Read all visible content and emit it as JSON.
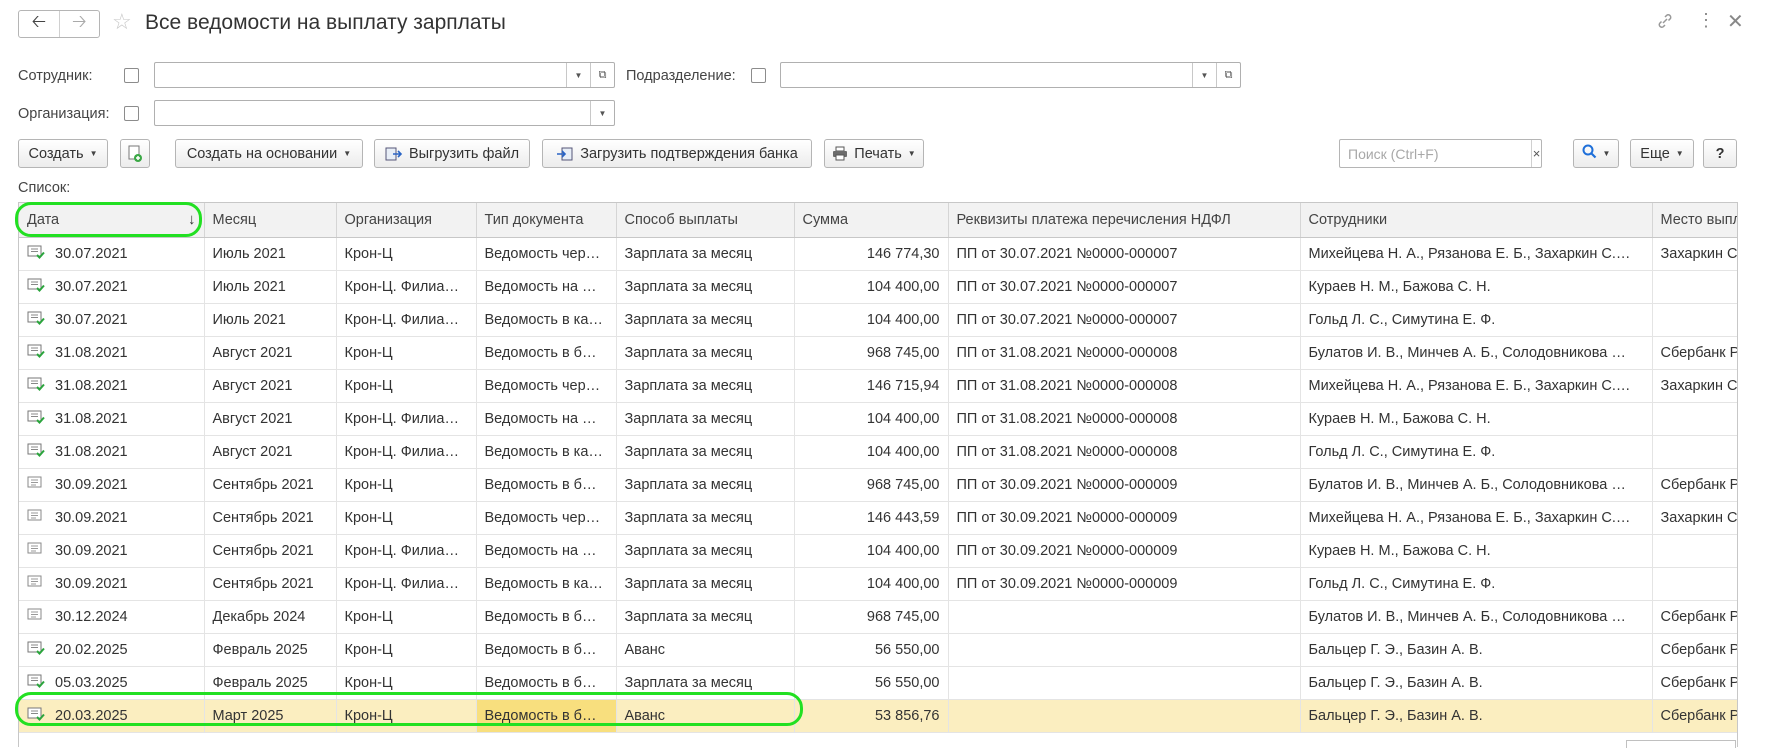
{
  "window": {
    "title": "Все ведомости на выплату зарплаты",
    "back_icon": "arrow-left-icon",
    "forward_icon": "arrow-right-icon",
    "favorite_icon": "star-icon",
    "link_icon": "link-icon",
    "more_icon": "more-vertical-icon",
    "close_icon": "close-icon"
  },
  "filters": {
    "employee_label": "Сотрудник:",
    "department_label": "Подразделение:",
    "organization_label": "Организация:",
    "employee_value": "",
    "department_value": "",
    "organization_value": ""
  },
  "toolbar": {
    "create": "Создать",
    "create_based_on": "Создать на основании",
    "export_file": "Выгрузить файл",
    "load_bank_confirm": "Загрузить подтверждения банка",
    "print": "Печать",
    "search_placeholder": "Поиск (Ctrl+F)",
    "search_clear": "×",
    "more": "Еще",
    "help": "?"
  },
  "list_label": "Список:",
  "table": {
    "columns": [
      "Дата",
      "Месяц",
      "Организация",
      "Тип документа",
      "Способ выплаты",
      "Сумма",
      "Реквизиты платежа перечисления НДФЛ",
      "Сотрудники",
      "Место выпл"
    ],
    "sort_column": "Дата",
    "sort_direction": "↓",
    "rows": [
      {
        "date": "30.07.2021",
        "month": "Июль 2021",
        "org": "Крон-Ц",
        "type": "Ведомость чер…",
        "method": "Зарплата за месяц",
        "sum": "146 774,30",
        "ndfl": "ПП от 30.07.2021 №0000-000007",
        "employees": "Михейцева Н. А., Рязанова Е. Б., Захаркин С.…",
        "place": "Захаркин Са",
        "posted": true
      },
      {
        "date": "30.07.2021",
        "month": "Июль 2021",
        "org": "Крон-Ц. Филиа…",
        "type": "Ведомость на …",
        "method": "Зарплата за месяц",
        "sum": "104 400,00",
        "ndfl": "ПП от 30.07.2021 №0000-000007",
        "employees": "Кураев Н. М., Бажова С. Н.",
        "place": "",
        "posted": true
      },
      {
        "date": "30.07.2021",
        "month": "Июль 2021",
        "org": "Крон-Ц. Филиа…",
        "type": "Ведомость в ка…",
        "method": "Зарплата за месяц",
        "sum": "104 400,00",
        "ndfl": "ПП от 30.07.2021 №0000-000007",
        "employees": "Гольд Л. С., Симутина Е. Ф.",
        "place": "",
        "posted": true
      },
      {
        "date": "31.08.2021",
        "month": "Август 2021",
        "org": "Крон-Ц",
        "type": "Ведомость в б…",
        "method": "Зарплата за месяц",
        "sum": "968 745,00",
        "ndfl": "ПП от 31.08.2021 №0000-000008",
        "employees": "Булатов И. В., Минчев А. Б., Солодовникова …",
        "place": "Сбербанк Ро",
        "posted": true
      },
      {
        "date": "31.08.2021",
        "month": "Август 2021",
        "org": "Крон-Ц",
        "type": "Ведомость чер…",
        "method": "Зарплата за месяц",
        "sum": "146 715,94",
        "ndfl": "ПП от 31.08.2021 №0000-000008",
        "employees": "Михейцева Н. А., Рязанова Е. Б., Захаркин С.…",
        "place": "Захаркин Са",
        "posted": true
      },
      {
        "date": "31.08.2021",
        "month": "Август 2021",
        "org": "Крон-Ц. Филиа…",
        "type": "Ведомость на …",
        "method": "Зарплата за месяц",
        "sum": "104 400,00",
        "ndfl": "ПП от 31.08.2021 №0000-000008",
        "employees": "Кураев Н. М., Бажова С. Н.",
        "place": "",
        "posted": true
      },
      {
        "date": "31.08.2021",
        "month": "Август 2021",
        "org": "Крон-Ц. Филиа…",
        "type": "Ведомость в ка…",
        "method": "Зарплата за месяц",
        "sum": "104 400,00",
        "ndfl": "ПП от 31.08.2021 №0000-000008",
        "employees": "Гольд Л. С., Симутина Е. Ф.",
        "place": "",
        "posted": true
      },
      {
        "date": "30.09.2021",
        "month": "Сентябрь 2021",
        "org": "Крон-Ц",
        "type": "Ведомость в б…",
        "method": "Зарплата за месяц",
        "sum": "968 745,00",
        "ndfl": "ПП от 30.09.2021 №0000-000009",
        "employees": "Булатов И. В., Минчев А. Б., Солодовникова …",
        "place": "Сбербанк Ро",
        "posted": false
      },
      {
        "date": "30.09.2021",
        "month": "Сентябрь 2021",
        "org": "Крон-Ц",
        "type": "Ведомость чер…",
        "method": "Зарплата за месяц",
        "sum": "146 443,59",
        "ndfl": "ПП от 30.09.2021 №0000-000009",
        "employees": "Михейцева Н. А., Рязанова Е. Б., Захаркин С.…",
        "place": "Захаркин Са",
        "posted": false
      },
      {
        "date": "30.09.2021",
        "month": "Сентябрь 2021",
        "org": "Крон-Ц. Филиа…",
        "type": "Ведомость на …",
        "method": "Зарплата за месяц",
        "sum": "104 400,00",
        "ndfl": "ПП от 30.09.2021 №0000-000009",
        "employees": "Кураев Н. М., Бажова С. Н.",
        "place": "",
        "posted": false
      },
      {
        "date": "30.09.2021",
        "month": "Сентябрь 2021",
        "org": "Крон-Ц. Филиа…",
        "type": "Ведомость в ка…",
        "method": "Зарплата за месяц",
        "sum": "104 400,00",
        "ndfl": "ПП от 30.09.2021 №0000-000009",
        "employees": "Гольд Л. С., Симутина Е. Ф.",
        "place": "",
        "posted": false
      },
      {
        "date": "30.12.2024",
        "month": "Декабрь 2024",
        "org": "Крон-Ц",
        "type": "Ведомость в б…",
        "method": "Зарплата за месяц",
        "sum": "968 745,00",
        "ndfl": "",
        "employees": "Булатов И. В., Минчев А. Б., Солодовникова …",
        "place": "Сбербанк Ро",
        "posted": false
      },
      {
        "date": "20.02.2025",
        "month": "Февраль 2025",
        "org": "Крон-Ц",
        "type": "Ведомость в б…",
        "method": "Аванс",
        "sum": "56 550,00",
        "ndfl": "",
        "employees": "Бальцер Г. Э., Базин А. В.",
        "place": "Сбербанк Ро",
        "posted": true
      },
      {
        "date": "05.03.2025",
        "month": "Февраль 2025",
        "org": "Крон-Ц",
        "type": "Ведомость в б…",
        "method": "Зарплата за месяц",
        "sum": "56 550,00",
        "ndfl": "",
        "employees": "Бальцер Г. Э., Базин А. В.",
        "place": "Сбербанк Ро",
        "posted": true
      },
      {
        "date": "20.03.2025",
        "month": "Март 2025",
        "org": "Крон-Ц",
        "type": "Ведомость в б…",
        "method": "Аванс",
        "sum": "53 856,76",
        "ndfl": "",
        "employees": "Бальцер Г. Э., Базин А. В.",
        "place": "Сбербанк Ро",
        "posted": true,
        "selected": true
      }
    ]
  },
  "colors": {
    "selected_row": "#fbeec0",
    "selected_cell": "#f8df7e",
    "highlight_outline": "#22e022",
    "search_accent": "#1e6fd9"
  }
}
